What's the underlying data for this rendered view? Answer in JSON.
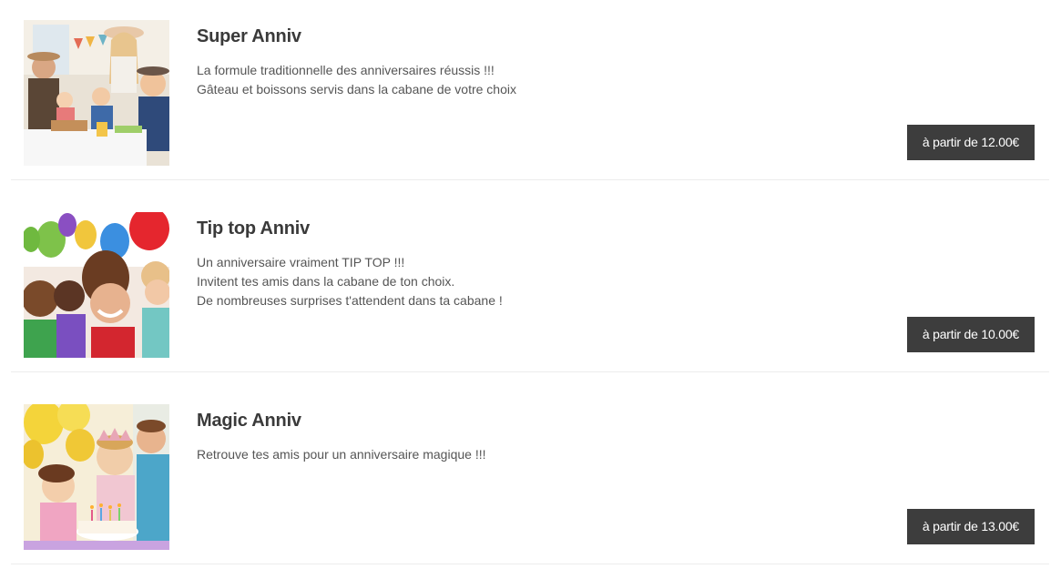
{
  "offers": [
    {
      "title": "Super Anniv",
      "lines": [
        "La formule traditionnelle des anniversaires réussis !!!",
        "Gâteau et boissons servis dans la cabane de votre choix"
      ],
      "price_label": "à partir de 12.00€",
      "image": "family-birthday-party-photo"
    },
    {
      "title": "Tip top Anniv",
      "lines": [
        "Un anniversaire vraiment TIP TOP !!!",
        "Invitent tes amis dans la cabane de ton choix.",
        "De nombreuses surprises t'attendent dans ta cabane !"
      ],
      "price_label": "à partir de 10.00€",
      "image": "kids-with-balloons-photo"
    },
    {
      "title": "Magic Anniv",
      "lines": [
        "Retrouve tes amis pour un anniversaire magique !!!"
      ],
      "price_label": "à partir de 13.00€",
      "image": "girl-blowing-candles-photo"
    }
  ]
}
